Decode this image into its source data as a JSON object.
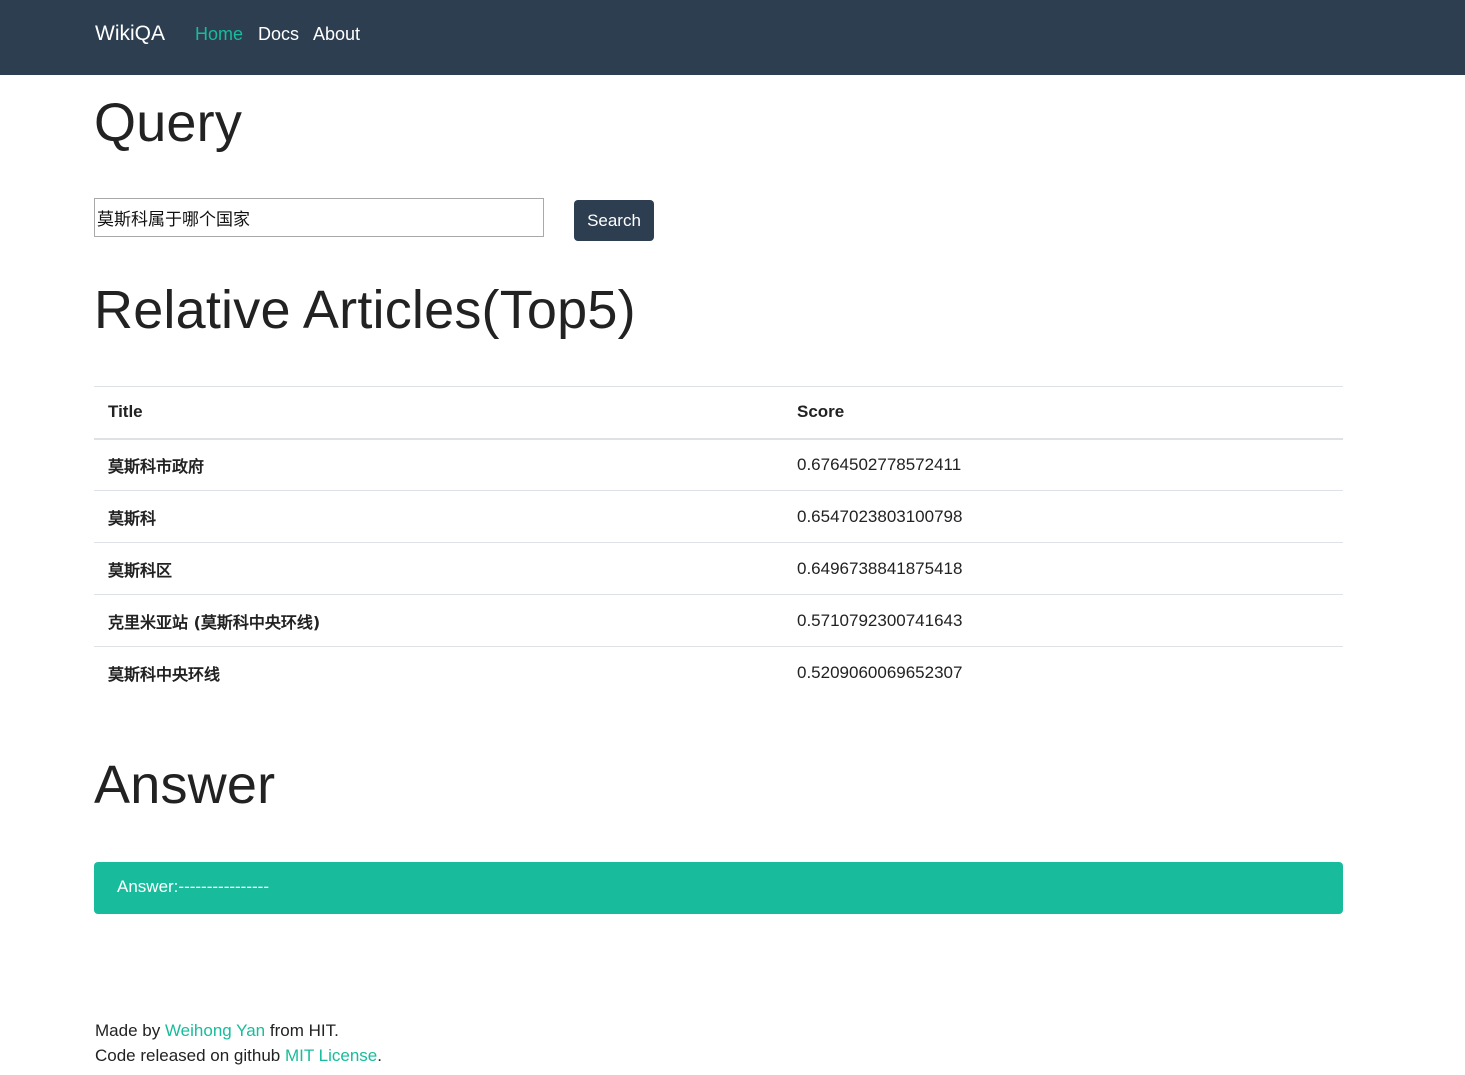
{
  "nav": {
    "brand": "WikiQA",
    "links": [
      "Home",
      "Docs",
      "About"
    ]
  },
  "query": {
    "heading": "Query",
    "input_value": "莫斯科属于哪个国家",
    "button_label": "Search"
  },
  "articles": {
    "heading": "Relative Articles(Top5)",
    "columns": [
      "Title",
      "Score"
    ],
    "rows": [
      {
        "title": "莫斯科市政府",
        "score": "0.6764502778572411"
      },
      {
        "title": "莫斯科",
        "score": "0.6547023803100798"
      },
      {
        "title": "莫斯科区",
        "score": "0.6496738841875418"
      },
      {
        "title": "克里米亚站 (莫斯科中央环线)",
        "score": "0.5710792300741643"
      },
      {
        "title": "莫斯科中央环线",
        "score": "0.5209060069652307"
      }
    ]
  },
  "answer": {
    "heading": "Answer",
    "text": "Answer:----------------"
  },
  "footer": {
    "line1_prefix": "Made by ",
    "author_link": "Weihong Yan",
    "line1_suffix": " from HIT.",
    "line2_prefix": "Code released on github ",
    "license_link": "MIT License",
    "line2_suffix": "."
  },
  "colors": {
    "navbar": "#2c3e50",
    "accent": "#18bc9c"
  }
}
